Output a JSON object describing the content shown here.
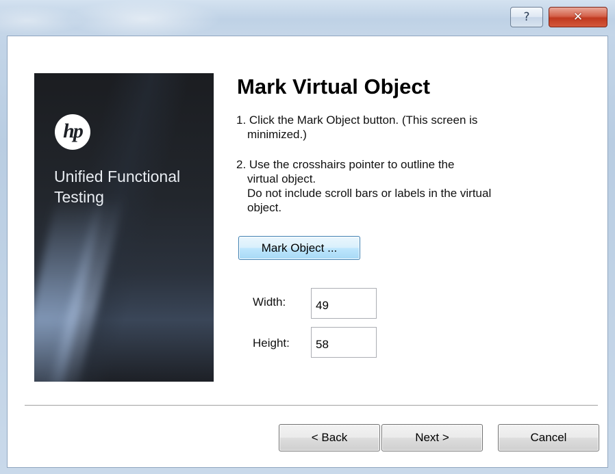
{
  "titlebar": {
    "help_glyph": "?",
    "close_glyph": "✕"
  },
  "banner": {
    "logo_text": "hp",
    "product_name": "Unified Functional\nTesting"
  },
  "main": {
    "title": "Mark Virtual Object",
    "step1_line1": "1. Click the Mark Object button. (This screen is",
    "step1_line2": "minimized.)",
    "step2_line1": "2. Use the crosshairs pointer to outline the",
    "step2_line2": "virtual object.",
    "step2_line3": "Do not include scroll bars or labels in the virtual",
    "step2_line4": "object.",
    "mark_button_label": "Mark Object ...",
    "width_label": "Width:",
    "width_value": "49",
    "height_label": "Height:",
    "height_value": "58"
  },
  "footer": {
    "back_label": "< Back",
    "next_label": "Next >",
    "cancel_label": "Cancel"
  },
  "colors": {
    "close_button": "#c0391f",
    "mark_button_border": "#3c7fb1",
    "banner_background": "#1b1d21"
  }
}
